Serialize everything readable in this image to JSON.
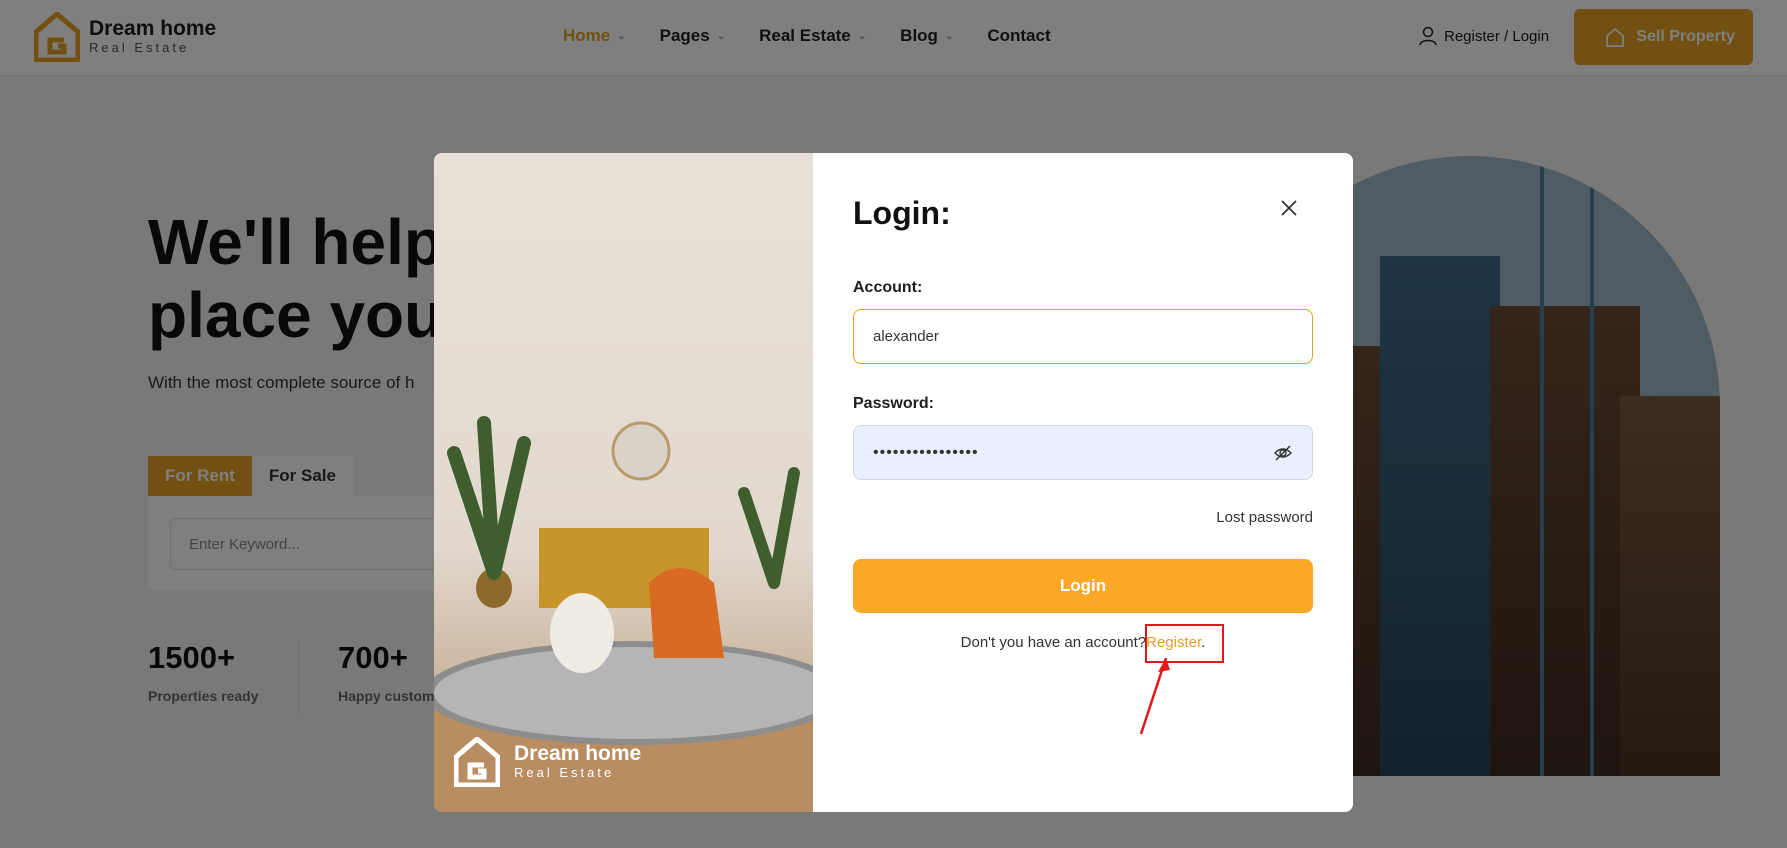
{
  "header": {
    "logo_name": "Dream home",
    "logo_sub": "Real Estate",
    "nav": [
      {
        "label": "Home",
        "active": true,
        "dropdown": true
      },
      {
        "label": "Pages",
        "active": false,
        "dropdown": true
      },
      {
        "label": "Real Estate",
        "active": false,
        "dropdown": true
      },
      {
        "label": "Blog",
        "active": false,
        "dropdown": true
      },
      {
        "label": "Contact",
        "active": false,
        "dropdown": false
      }
    ],
    "register_login": "Register / Login",
    "sell_button": "Sell Property"
  },
  "hero": {
    "title_line1": "We'll help",
    "title_line2": "place you",
    "subtitle": "With the most complete source of h",
    "tabs": [
      "For Rent",
      "For Sale"
    ],
    "keyword_placeholder": "Enter Keyword...",
    "stats": [
      {
        "value": "1500+",
        "label": "Properties ready"
      },
      {
        "value": "700+",
        "label": "Happy custom"
      }
    ]
  },
  "modal": {
    "logo_name": "Dream home",
    "logo_sub": "Real Estate",
    "title": "Login:",
    "account_label": "Account:",
    "account_value": "alexander",
    "password_label": "Password:",
    "password_value": "••••••••••••••••",
    "lost_password": "Lost password",
    "login_button": "Login",
    "no_account_text": "Don't you have an account?",
    "register_link": "Register",
    "register_suffix": "."
  },
  "colors": {
    "accent": "#e3a024",
    "button": "#fba927",
    "highlight": "#e0181b"
  }
}
